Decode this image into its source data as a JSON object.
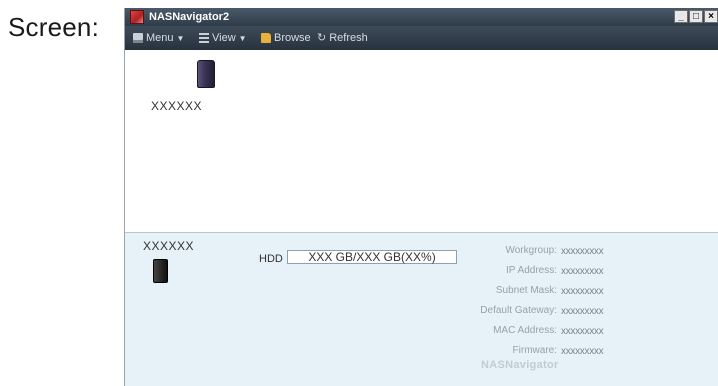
{
  "caption": "Screen:",
  "window": {
    "title": "NASNavigator2",
    "buttons": {
      "minimize": "_",
      "maximize": "□",
      "close": "×"
    }
  },
  "toolbar": {
    "menu": "Menu",
    "view": "View",
    "browse": "Browse",
    "refresh": "Refresh"
  },
  "devices": [
    {
      "name": "XXXXXX"
    }
  ],
  "details": {
    "name": "XXXXXX",
    "hdd_label": "HDD",
    "hdd_value": "XXX GB/XXX GB(XX%)",
    "fields": [
      {
        "label": "Workgroup:",
        "value": "xxxxxxxxx"
      },
      {
        "label": "IP Address:",
        "value": "xxxxxxxxx"
      },
      {
        "label": "Subnet Mask:",
        "value": "xxxxxxxxx"
      },
      {
        "label": "Default Gateway:",
        "value": "xxxxxxxxx"
      },
      {
        "label": "MAC Address:",
        "value": "xxxxxxxxx"
      },
      {
        "label": "Firmware:",
        "value": "xxxxxxxxx"
      }
    ],
    "brand": "NASNavigator"
  }
}
